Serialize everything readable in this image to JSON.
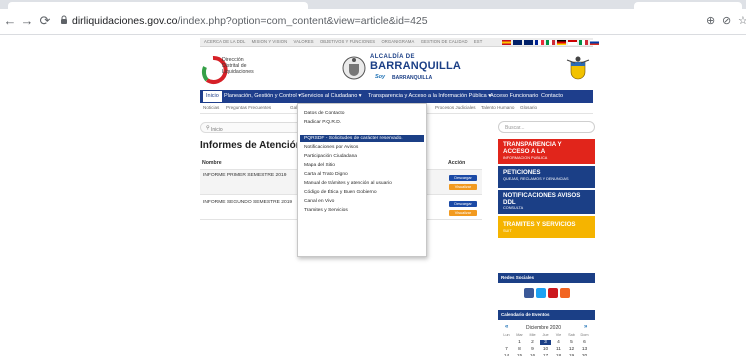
{
  "browser": {
    "url_host": "dirliquidaciones.gov.co",
    "url_path": "/index.php?option=com_content&view=article&id=425",
    "back_icon": "back-arrow-icon",
    "forward_icon": "forward-arrow-icon",
    "reload_icon": "reload-icon",
    "lock_icon": "lock-icon"
  },
  "topstrip": {
    "links": [
      "ACERCA DE LA DDL",
      "MISION Y VISION",
      "VALORES",
      "OBJETIVOS Y FUNCIONES",
      "ORGANIGRAMA",
      "GESTION DE CALIDAD",
      "EST"
    ]
  },
  "header": {
    "ddl_line1": "Dirección",
    "ddl_line2": "Distrital de",
    "ddl_line3": "Liquidaciones",
    "alcaldia": "ALCALDÍA DE",
    "barranquilla": "BARRANQUILLA",
    "soy": "Soy",
    "soy_b": "BARRANQUILLA"
  },
  "nav": {
    "items": [
      "Inicio",
      "Planeación, Gestión y Control ▾",
      "Servicios al Ciudadano ▾",
      "Transparencia y Acceso a la Información Pública ▾",
      "Acceso Funcionario",
      "Contacto"
    ]
  },
  "subnav": {
    "items": [
      "Noticias",
      "Preguntas Frecuentes",
      "Gal",
      "Procesos Judiciales",
      "Talento Humano",
      "Glosario"
    ]
  },
  "breadcrumb": {
    "label": "Inicio"
  },
  "main": {
    "heading": "Informes de Atención a l",
    "col_name": "Nombre",
    "col_action": "Acción",
    "rows": [
      {
        "name": "INFORME PRIMER SEMESTRE 2019",
        "download": "Descargar",
        "view": "Visualizar"
      },
      {
        "name": "INFORME SEGUNDO SEMESTRE 2019",
        "download": "Descargar",
        "view": "Visualizar"
      }
    ]
  },
  "dropdown": {
    "items": [
      "Datos de Contacto",
      "Radicar P.Q.R.D.",
      "PQRSDF - Solicitudes de carácter reservado.",
      "Notificaciones por Avisos",
      "Participación Ciudadana",
      "Mapa del Sitio",
      "Carta al Trato Digno",
      "Manual de trámites y atención al usuario",
      "Código de Ética y Buen Gobierno",
      "Canal en Vivo",
      "Tramites y Servicios"
    ],
    "selected_index": 2
  },
  "sidebar": {
    "search_placeholder": "Buscar...",
    "banners": [
      {
        "t1a": "TRANSPARENCIA Y",
        "t1b": "ACCESO A LA",
        "t2": "INFORMACION PUBLICA",
        "color": "#e1251b"
      },
      {
        "t1a": "PETICIONES",
        "t1b": "",
        "t2": "QUEJAS, RECLAMOS Y DENUNCIAS",
        "color": "#1b3f86"
      },
      {
        "t1a": "NOTIFICACIONES AVISOS",
        "t1b": "DDL",
        "t2": "CONSULTA",
        "color": "#1b3f86"
      },
      {
        "t1a": "TRAMITES Y SERVICIOS",
        "t1b": "",
        "t2": "SUIT",
        "color": "#f5b400"
      }
    ],
    "redes_title": "Redes Sociales",
    "social_icons": [
      "facebook-icon",
      "twitter-icon",
      "youtube-icon",
      "rss-icon"
    ],
    "calendar_title": "Calendario de Eventos"
  },
  "calendar": {
    "month": "Diciembre 2020",
    "prev": "«",
    "next": "»",
    "dow": [
      "Lun",
      "Mar",
      "Mie",
      "Jue",
      "Vie",
      "Sab",
      "Dom"
    ],
    "weeks": [
      [
        "",
        "1",
        "2",
        "3",
        "4",
        "5",
        "6"
      ],
      [
        "7",
        "8",
        "9",
        "10",
        "11",
        "12",
        "13"
      ],
      [
        "14",
        "15",
        "16",
        "17",
        "18",
        "19",
        "20"
      ],
      [
        "21",
        "22",
        "23",
        "24",
        "25",
        "26",
        "27"
      ],
      [
        "28",
        "29",
        "30",
        "31",
        "",
        "",
        ""
      ]
    ],
    "today": "3"
  },
  "colors": {
    "nav_blue": "#1e3e8c",
    "accent_orange": "#f29a1f",
    "accent_red": "#e1251b"
  }
}
